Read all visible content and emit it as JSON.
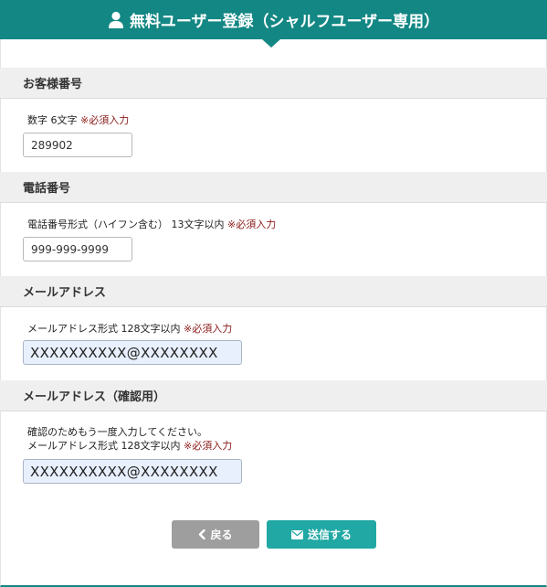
{
  "header": {
    "title": "無料ユーザー登録（シャルフユーザー専用）",
    "icon": "user-icon",
    "color": "#138784"
  },
  "sections": {
    "customer_number": {
      "label": "お客様番号",
      "hint": "数字 6文字",
      "required": "※必須入力",
      "value": "289902"
    },
    "phone": {
      "label": "電話番号",
      "hint": "電話番号形式（ハイフン含む） 13文字以内",
      "required": "※必須入力",
      "value": "999-999-9999"
    },
    "email": {
      "label": "メールアドレス",
      "hint": "メールアドレス形式 128文字以内",
      "required": "※必須入力",
      "value": "XXXXXXXXXX@XXXXXXXX"
    },
    "email_confirm": {
      "label": "メールアドレス（確認用）",
      "note": "確認のためもう一度入力してください。",
      "hint": "メールアドレス形式 128文字以内",
      "required": "※必須入力",
      "value": "XXXXXXXXXX@XXXXXXXX"
    }
  },
  "buttons": {
    "back_label": "戻る",
    "back_icon": "chevron-left-icon",
    "send_label": "送信する",
    "send_icon": "envelope-icon",
    "back_color": "#9e9e9e",
    "send_color": "#22a8a4"
  },
  "colors": {
    "required": "#8b1a1a",
    "section_bg": "#efefef"
  }
}
